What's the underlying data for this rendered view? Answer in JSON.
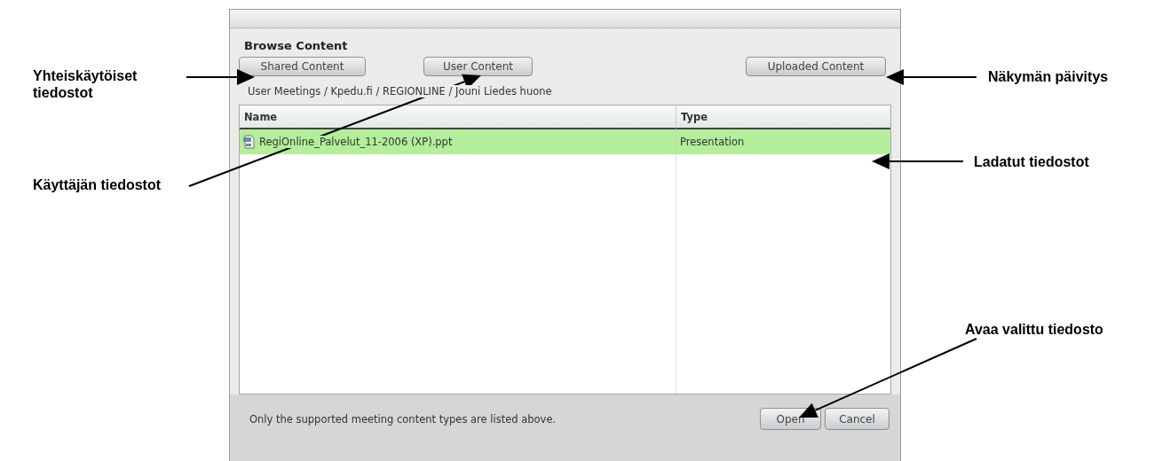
{
  "dialog": {
    "title": "Browse Content",
    "source_buttons": [
      {
        "label": "Shared Content"
      },
      {
        "label": "User Content"
      },
      {
        "label": "Uploaded Content"
      }
    ],
    "breadcrumb": "User Meetings / Kpedu.fi / REGIONLINE / Jouni Liedes huone",
    "table": {
      "columns": [
        "Name",
        "Type"
      ],
      "rows": [
        {
          "name": "RegiOnline_Palvelut_11-2006 (XP).ppt",
          "type": "Presentation",
          "selected": true
        }
      ]
    },
    "footer_note": "Only the supported meeting content types are listed above.",
    "action_buttons": [
      {
        "label": "Open"
      },
      {
        "label": "Cancel"
      }
    ]
  },
  "annotations": [
    {
      "text": "Yhteiskäytöiset tiedostot"
    },
    {
      "text": "Käyttäjän tiedostot"
    },
    {
      "text": "Näkymän päivitys"
    },
    {
      "text": "Ladatut tiedostot"
    },
    {
      "text": "Avaa valittu tiedosto"
    }
  ]
}
